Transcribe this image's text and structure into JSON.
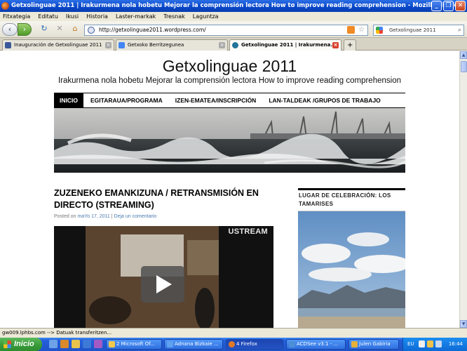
{
  "window": {
    "title": "Getxolinguae 2011 | Irakurmena nola hobetu Mejorar la comprensión lectora How to improve reading comprehension - Mozilla Firefox"
  },
  "menu": [
    "Fitxategia",
    "Editatu",
    "Ikusi",
    "Historia",
    "Laster-markak",
    "Tresnak",
    "Laguntza"
  ],
  "nav": {
    "url": "http://getxolinguae2011.wordpress.com/",
    "search_value": "Getxolinguae 2011"
  },
  "tabs": [
    {
      "label": "Inauguración de Getxolinguae 2011",
      "active": false
    },
    {
      "label": "Getxoko Berritzegunea",
      "active": false
    },
    {
      "label": "Getxolinguae 2011 | Irakurmena...",
      "active": true
    }
  ],
  "site": {
    "title": "Getxolinguae 2011",
    "description": "Irakurmena nola hobetu Mejorar la comprensión lectora How to improve reading comprehension",
    "menu": [
      "INICIO",
      "EGITARAUA/PROGRAMA",
      "IZEN-EMATEA/INSCRIPCIÓN",
      "LAN-TALDEAK /GRUPOS DE TRABAJO"
    ]
  },
  "post": {
    "title": "ZUZENEKO EMANKIZUNA / RETRANSMISIÓN EN DIRECTO (STREAMING)",
    "meta_prefix": "Posted on",
    "date": "maYo 17, 2011",
    "separator": "|",
    "comment_link": "Deja un comentario",
    "video_brand": "USTREAM"
  },
  "sidebar": {
    "widget_title": "LUGAR DE CELEBRACIÓN: LOS TAMARISES"
  },
  "status": {
    "text": "gw009.lphbs.com --> Datuak transferitzen..."
  },
  "taskbar": {
    "start_label": "Inicio",
    "items": [
      {
        "label": "2 Microsoft Of...",
        "active": false
      },
      {
        "label": "Adnana Bizkaie ...",
        "active": false
      },
      {
        "label": "4 Firefox",
        "active": true
      },
      {
        "label": "ACDSee v3.1 - ...",
        "active": false
      },
      {
        "label": "Julen Gabiria",
        "active": false
      }
    ],
    "language": "EU",
    "clock": "16:44"
  },
  "colors": {
    "xp_blue": "#245edb",
    "start_green": "#3a9d3a",
    "nav_active_bg": "#000000",
    "link": "#4a7bb0"
  }
}
